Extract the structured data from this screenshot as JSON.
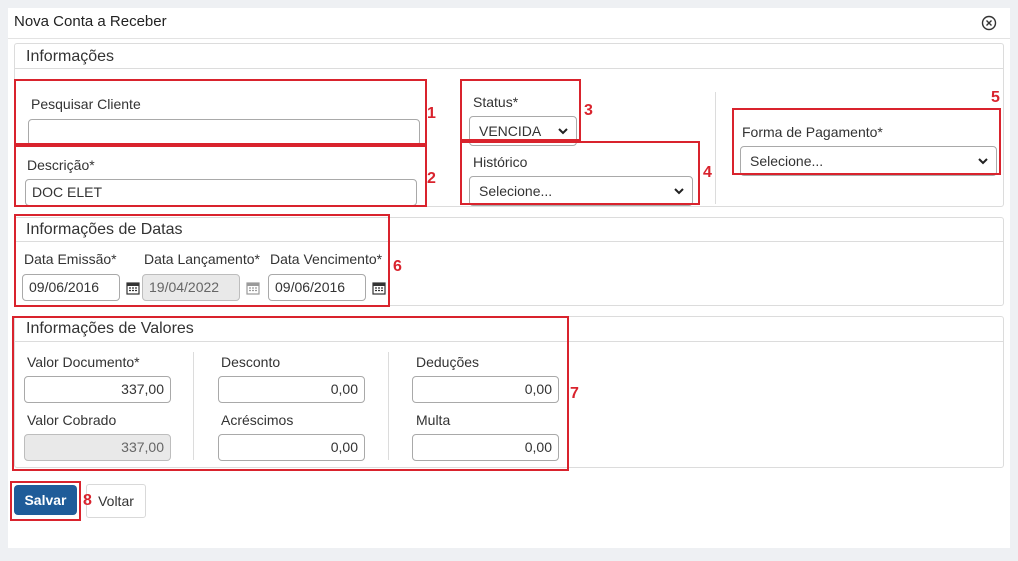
{
  "dialog": {
    "title": "Nova Conta a Receber",
    "close_icon": "close-circle-icon"
  },
  "informacoes": {
    "title": "Informações",
    "pesquisar_cliente": {
      "label": "Pesquisar Cliente",
      "value": ""
    },
    "descricao": {
      "label": "Descrição*",
      "value": "DOC ELET"
    },
    "status": {
      "label": "Status*",
      "value": "VENCIDA"
    },
    "historico": {
      "label": "Histórico",
      "value": "Selecione..."
    },
    "forma_pagamento": {
      "label": "Forma de Pagamento*",
      "value": "Selecione..."
    }
  },
  "datas": {
    "title": "Informações de Datas",
    "emissao": {
      "label": "Data Emissão*",
      "value": "09/06/2016"
    },
    "lancamento": {
      "label": "Data Lançamento*",
      "value": "19/04/2022"
    },
    "vencimento": {
      "label": "Data Vencimento*",
      "value": "09/06/2016"
    }
  },
  "valores": {
    "title": "Informações de Valores",
    "valor_documento": {
      "label": "Valor Documento*",
      "value": "337,00"
    },
    "valor_cobrado": {
      "label": "Valor Cobrado",
      "value": "337,00"
    },
    "desconto": {
      "label": "Desconto",
      "value": "0,00"
    },
    "acrescimos": {
      "label": "Acréscimos",
      "value": "0,00"
    },
    "deducoes": {
      "label": "Deduções",
      "value": "0,00"
    },
    "multa": {
      "label": "Multa",
      "value": "0,00"
    }
  },
  "buttons": {
    "save": "Salvar",
    "back": "Voltar"
  },
  "annotations": [
    "1",
    "2",
    "3",
    "4",
    "5",
    "6",
    "7",
    "8"
  ],
  "colors": {
    "annotation": "#d9232d",
    "primary_button": "#1f5c99"
  }
}
